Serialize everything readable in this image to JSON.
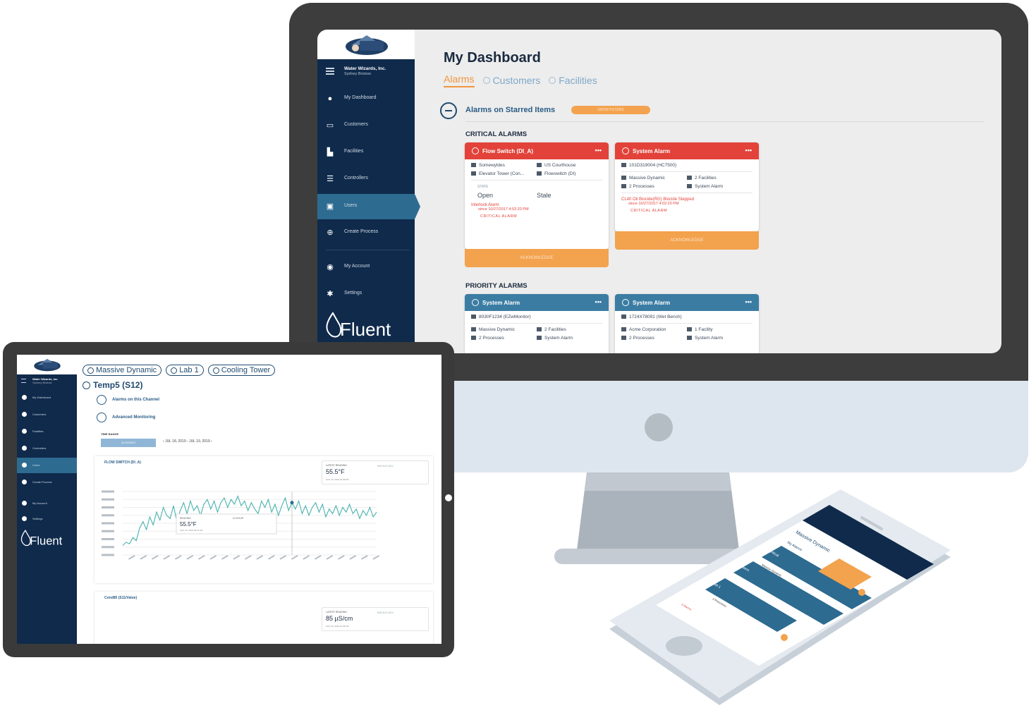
{
  "desktop": {
    "sidebar": {
      "org_name": "Water Wizards, Inc.",
      "org_user": "Sydney Bristow",
      "items": [
        {
          "label": "My Dashboard",
          "icon": "dashboard-icon"
        },
        {
          "label": "Customers",
          "icon": "customers-icon"
        },
        {
          "label": "Facilities",
          "icon": "facilities-icon"
        },
        {
          "label": "Controllers",
          "icon": "controllers-icon"
        },
        {
          "label": "Users",
          "icon": "users-icon"
        },
        {
          "label": "Create Process",
          "icon": "add-icon"
        },
        {
          "label": "My Account",
          "icon": "account-icon"
        },
        {
          "label": "Settings",
          "icon": "gear-icon"
        }
      ]
    },
    "title": "My Dashboard",
    "tabs": [
      "Alarms",
      "Customers",
      "Facilities"
    ],
    "section_title": "Alarms on Starred Items",
    "section_pill": "SHOW FILTERS",
    "critical_heading": "CRITICAL ALARMS",
    "priority_heading": "PRIORITY ALARMS",
    "critical_cards": [
      {
        "title": "Flow Switch (DI_A)",
        "row1_left": "Somewyldes",
        "row1_right": "US Courthouse",
        "row2_left": "Elevator Tower (Con...",
        "row2_right": "Flowswitch (DI)",
        "state_label": "STATE",
        "state_value": "Open",
        "state_stale": "Stale",
        "alarm_title": "Interlock Alarm",
        "alarm_since": "since 10/27/2017 4:02:20 PM",
        "critical": "CRITICAL ALARM",
        "action": "ACKNOWLEDGE"
      },
      {
        "title": "System Alarm",
        "row1_left": "101D319004 (HC7500)",
        "row2_left": "Massive Dynamic",
        "row2_right": "2 Facilities",
        "row3_left": "2 Processes",
        "row3_right": "System Alarm",
        "alarm_title": "CL40 Oil Biocide(RG) Biocide Stepped",
        "alarm_since": "since 10/27/2017 4:02:20 PM",
        "critical": "CRITICAL ALARM",
        "action": "ACKNOWLEDGE"
      }
    ],
    "priority_cards": [
      {
        "title": "System Alarm",
        "row1_left": "8030F1234 (EZwMonitor)",
        "row2_left": "Massive Dynamic",
        "row2_right": "2 Facilities",
        "row3_left": "2 Processes",
        "row3_right": "System Alarm"
      },
      {
        "title": "System Alarm",
        "row1_left": "1724X78091 (Wet Bench)",
        "row2_left": "Acme Corporation",
        "row2_right": "1 Facility",
        "row3_left": "2 Processes",
        "row3_right": "System Alarm"
      }
    ],
    "brand": "Fluent"
  },
  "tablet": {
    "sidebar": {
      "org_name": "Water Wizards, Inc.",
      "org_user": "Sydney Bristow",
      "items": [
        "My Dashboard",
        "Customers",
        "Facilities",
        "Controllers",
        "Users",
        "Create Process",
        "My Account",
        "Settings"
      ]
    },
    "crumbs": [
      "Massive Dynamic",
      "Lab 1",
      "Cooling Tower"
    ],
    "channel": "Temp5 (S12)",
    "alarms_toggle": "Alarms on this Channel",
    "monitoring_toggle": "Advanced Monitoring",
    "time_label": "TIME RANGE",
    "time_button": "24 HOURS",
    "time_range": "JUL 18, 2019 - JUL 19, 2019",
    "panels": [
      {
        "title": "FLOW SWITCH (DI_A)",
        "latest_label": "LATEST READING",
        "latest_value": "55.5°F",
        "latest_time": "AUG 15, 2019 01:48 AM",
        "stats": "MIN   AVG   MAX"
      },
      {
        "title": "Cond85 (S11/Value)",
        "latest_label": "LATEST READING",
        "latest_value": "85 µS/cm",
        "latest_time": "AUG 15, 2019 01:48 AM",
        "stats": "MIN   AVG   MAX"
      }
    ],
    "tooltip": {
      "label": "READING",
      "value": "55.5°F",
      "time": "AUG 15, 2019 03:47 AM",
      "range": "24 HOUR"
    },
    "chart_values": [
      40.1,
      40.3,
      40.2,
      40.6,
      40.4,
      41.2,
      41.6,
      41.1,
      41.9,
      41.4,
      42.2,
      41.7,
      42.5,
      42.0,
      41.8,
      42.6,
      41.6,
      42.3,
      42.8,
      42.1,
      42.9,
      42.3,
      42.6,
      42.0,
      42.7,
      43.0,
      42.4,
      42.9,
      42.2,
      42.8,
      43.1,
      42.5,
      43.0,
      42.7,
      43.2,
      42.6,
      42.9,
      42.3,
      42.8,
      42.4,
      42.1,
      42.9,
      42.5,
      43.0,
      42.2,
      42.7,
      42.0,
      42.6,
      43.1,
      42.3,
      42.8,
      42.4,
      42.9,
      42.1,
      42.6,
      42.0,
      42.5,
      42.8,
      42.2,
      42.7,
      41.9,
      42.4,
      42.1,
      42.6,
      42.0,
      42.5,
      42.2,
      42.7,
      42.1,
      42.4,
      41.8,
      42.3,
      42.0,
      42.5,
      41.9,
      42.2
    ],
    "brand": "Fluent"
  },
  "phone": {
    "crumb": "Massive Dynamic",
    "alarms": "My Alarms",
    "items": [
      "Critical",
      "Alarm",
      "Lab 1"
    ],
    "item_sub1": "Massive Dynamic",
    "item_sub2": "2 Processes",
    "item_alarm": "6 Alarms"
  }
}
